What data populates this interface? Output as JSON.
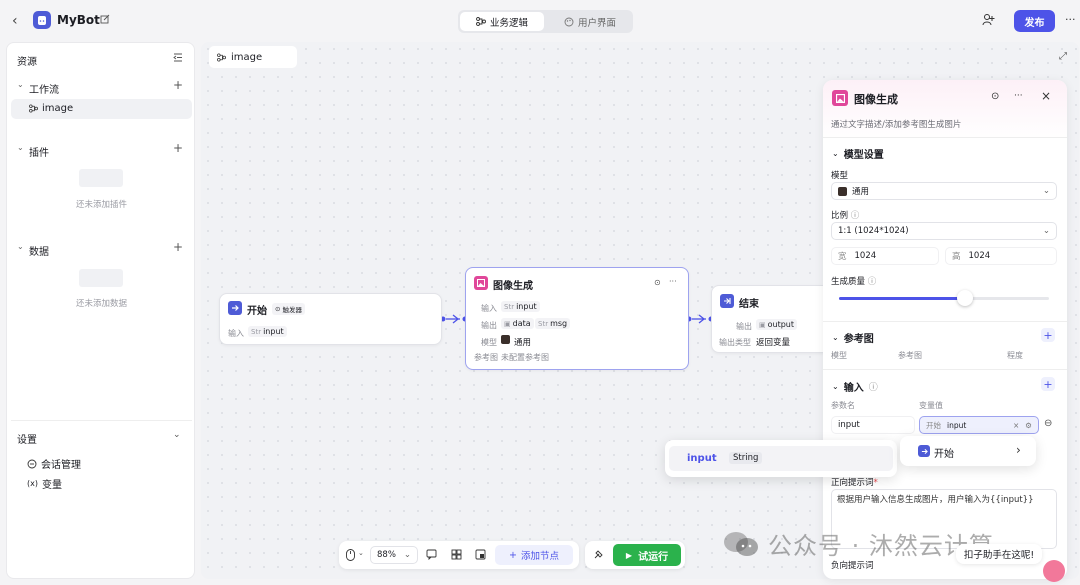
{
  "app": {
    "title": "MyBot"
  },
  "header": {
    "tab_logic": "业务逻辑",
    "tab_ui": "用户界面",
    "publish_label": "发布",
    "more": "···"
  },
  "sidebar": {
    "resources_title": "资源",
    "workflow_label": "工作流",
    "workflow_item": "image",
    "plugins_label": "插件",
    "plugins_empty": "还未添加插件",
    "data_label": "数据",
    "data_empty": "还未添加数据",
    "settings_label": "设置",
    "conversation_label": "会话管理",
    "variables_label": "变量",
    "variables_glyph": "(x)"
  },
  "canvas": {
    "tab_label": "image",
    "start_node": {
      "title": "开始",
      "badge": "触发器",
      "input_label": "输入",
      "type": "Str",
      "var": "input"
    },
    "image_node": {
      "title": "图像生成",
      "input_label": "输入",
      "input_type": "Str",
      "input_var": "input",
      "output_label": "输出",
      "output_var1": "data",
      "output_type2": "Str",
      "output_var2": "msg",
      "model_label": "模型",
      "model_value": "通用",
      "ref_label": "参考图",
      "ref_value": "未配置参考图"
    },
    "end_node": {
      "title": "结束",
      "output_label": "输出",
      "output_var": "output",
      "output_type_label": "输出类型",
      "output_type_value": "返回变量"
    }
  },
  "panel": {
    "title": "图像生成",
    "description": "通过文字描述/添加参考图生成图片",
    "model_settings": "模型设置",
    "model_label": "模型",
    "model_value": "通用",
    "ratio_label": "比例",
    "ratio_value": "1:1 (1024*1024)",
    "width_label": "宽",
    "width_value": "1024",
    "height_label": "高",
    "height_value": "1024",
    "quality_label": "生成质量",
    "quality_level": 0.6,
    "ref_section": "参考图",
    "ref_col1": "模型",
    "ref_col2": "参考图",
    "ref_col3": "程度",
    "input_section": "输入",
    "param_name_label": "参数名",
    "var_value_label": "变量值",
    "param_name_value": "input",
    "var_value_prefix": "开始",
    "var_value": "input",
    "prompt_label": "正向提示词",
    "prompt_value": "根据用户输入信息生成图片，用户输入为{{input}}",
    "neg_prompt_label": "负向提示词"
  },
  "popover": {
    "start_item": "开始",
    "var_name": "input",
    "var_type": "String"
  },
  "toolbar": {
    "zoom": "88%",
    "add_node": "添加节点",
    "test_run": "试运行"
  },
  "watermark": {
    "text": "公众号 · 沐然云计算",
    "helper": "扣子助手在这呢!"
  },
  "colors": {
    "accent": "#4d53e8",
    "image_icon": "#e0479a",
    "start_icon": "#4e5bd6",
    "run": "#2bb24c"
  }
}
